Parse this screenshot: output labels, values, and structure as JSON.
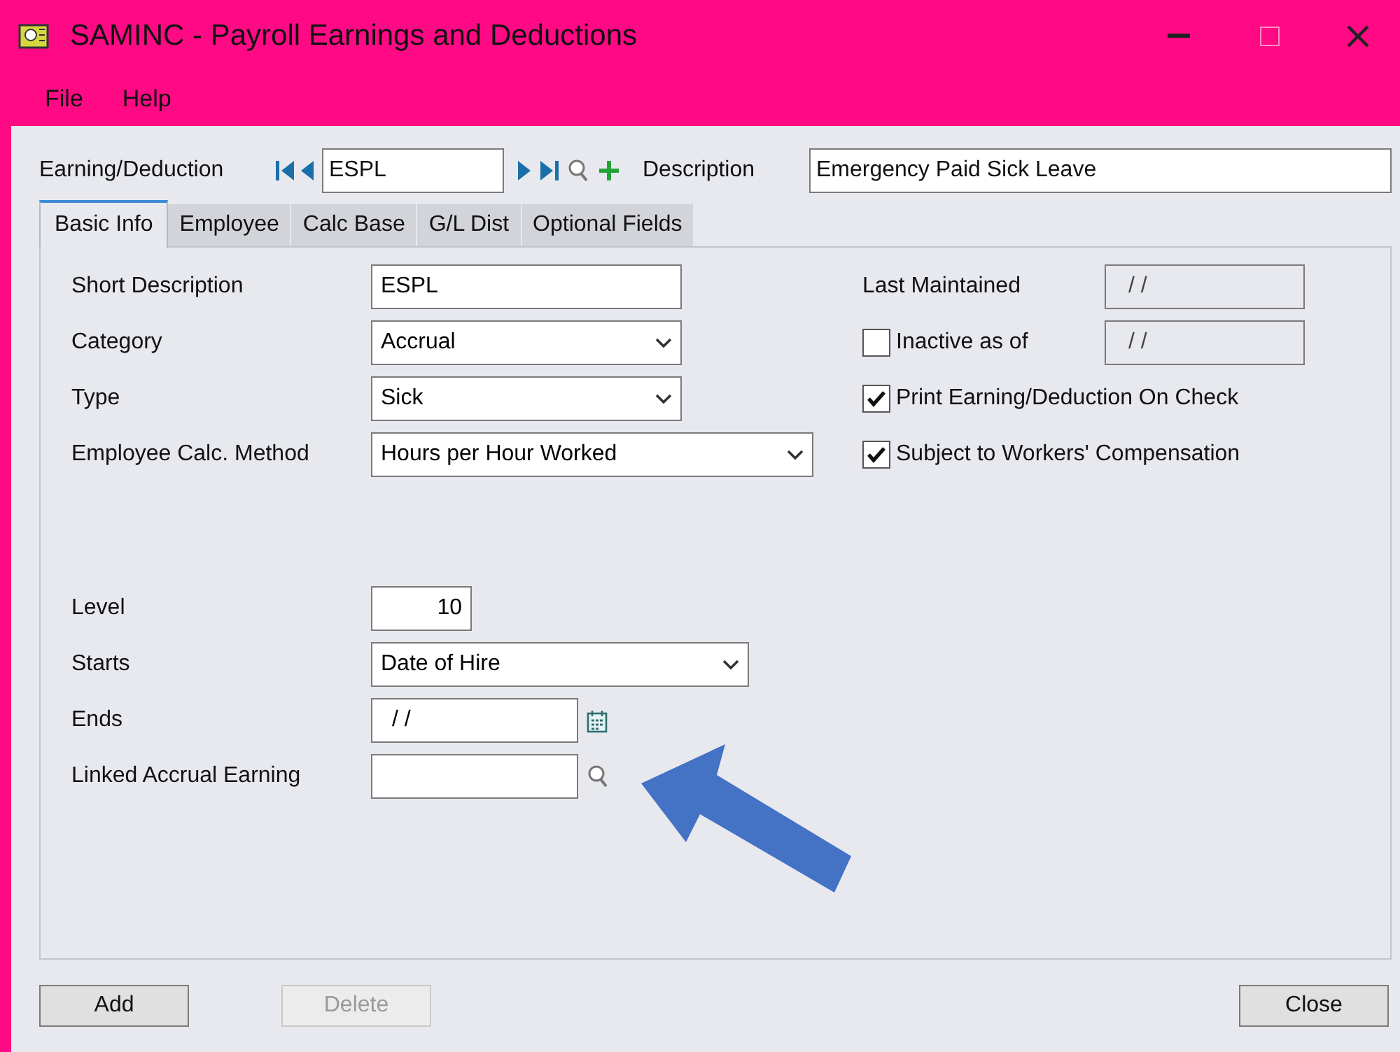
{
  "window": {
    "title": "SAMINC - Payroll Earnings and Deductions"
  },
  "menu": [
    "File",
    "Help"
  ],
  "header": {
    "label": "Earning/Deduction",
    "code": "ESPL",
    "description_label": "Description",
    "description": "Emergency Paid Sick Leave"
  },
  "tabs": [
    {
      "label": "Basic Info",
      "selected": true
    },
    {
      "label": "Employee",
      "selected": false
    },
    {
      "label": "Calc Base",
      "selected": false
    },
    {
      "label": "G/L Dist",
      "selected": false
    },
    {
      "label": "Optional Fields",
      "selected": false
    }
  ],
  "fields_top": [
    {
      "label": "Short Description",
      "kind": "text",
      "value": "ESPL"
    },
    {
      "label": "Category",
      "kind": "dropdown",
      "value": "Accrual"
    },
    {
      "label": "Type",
      "kind": "dropdown",
      "value": "Sick"
    },
    {
      "label": "Employee Calc. Method",
      "kind": "dropdown",
      "value": "Hours per Hour Worked"
    }
  ],
  "fields_bottom": [
    {
      "label": "Level",
      "kind": "number",
      "value": "10"
    },
    {
      "label": "Starts",
      "kind": "dropdown",
      "value": "Date of Hire"
    },
    {
      "label": "Ends",
      "kind": "date",
      "value": "/ /"
    },
    {
      "label": "Linked Accrual Earning",
      "kind": "lookup"
    }
  ],
  "options": [
    {
      "kind": "date",
      "label": "Last Maintained",
      "value": "/ /"
    },
    {
      "kind": "check_date",
      "label": "Inactive as of",
      "checked": false,
      "value": "/ /"
    },
    {
      "kind": "check",
      "label": "Print Earning/Deduction On Check",
      "checked": true
    },
    {
      "kind": "check",
      "label": "Subject to Workers' Compensation",
      "checked": true
    }
  ],
  "buttons": [
    {
      "label": "Add",
      "disabled": false
    },
    {
      "label": "Delete",
      "disabled": true
    },
    {
      "label": "Close",
      "disabled": false
    }
  ]
}
